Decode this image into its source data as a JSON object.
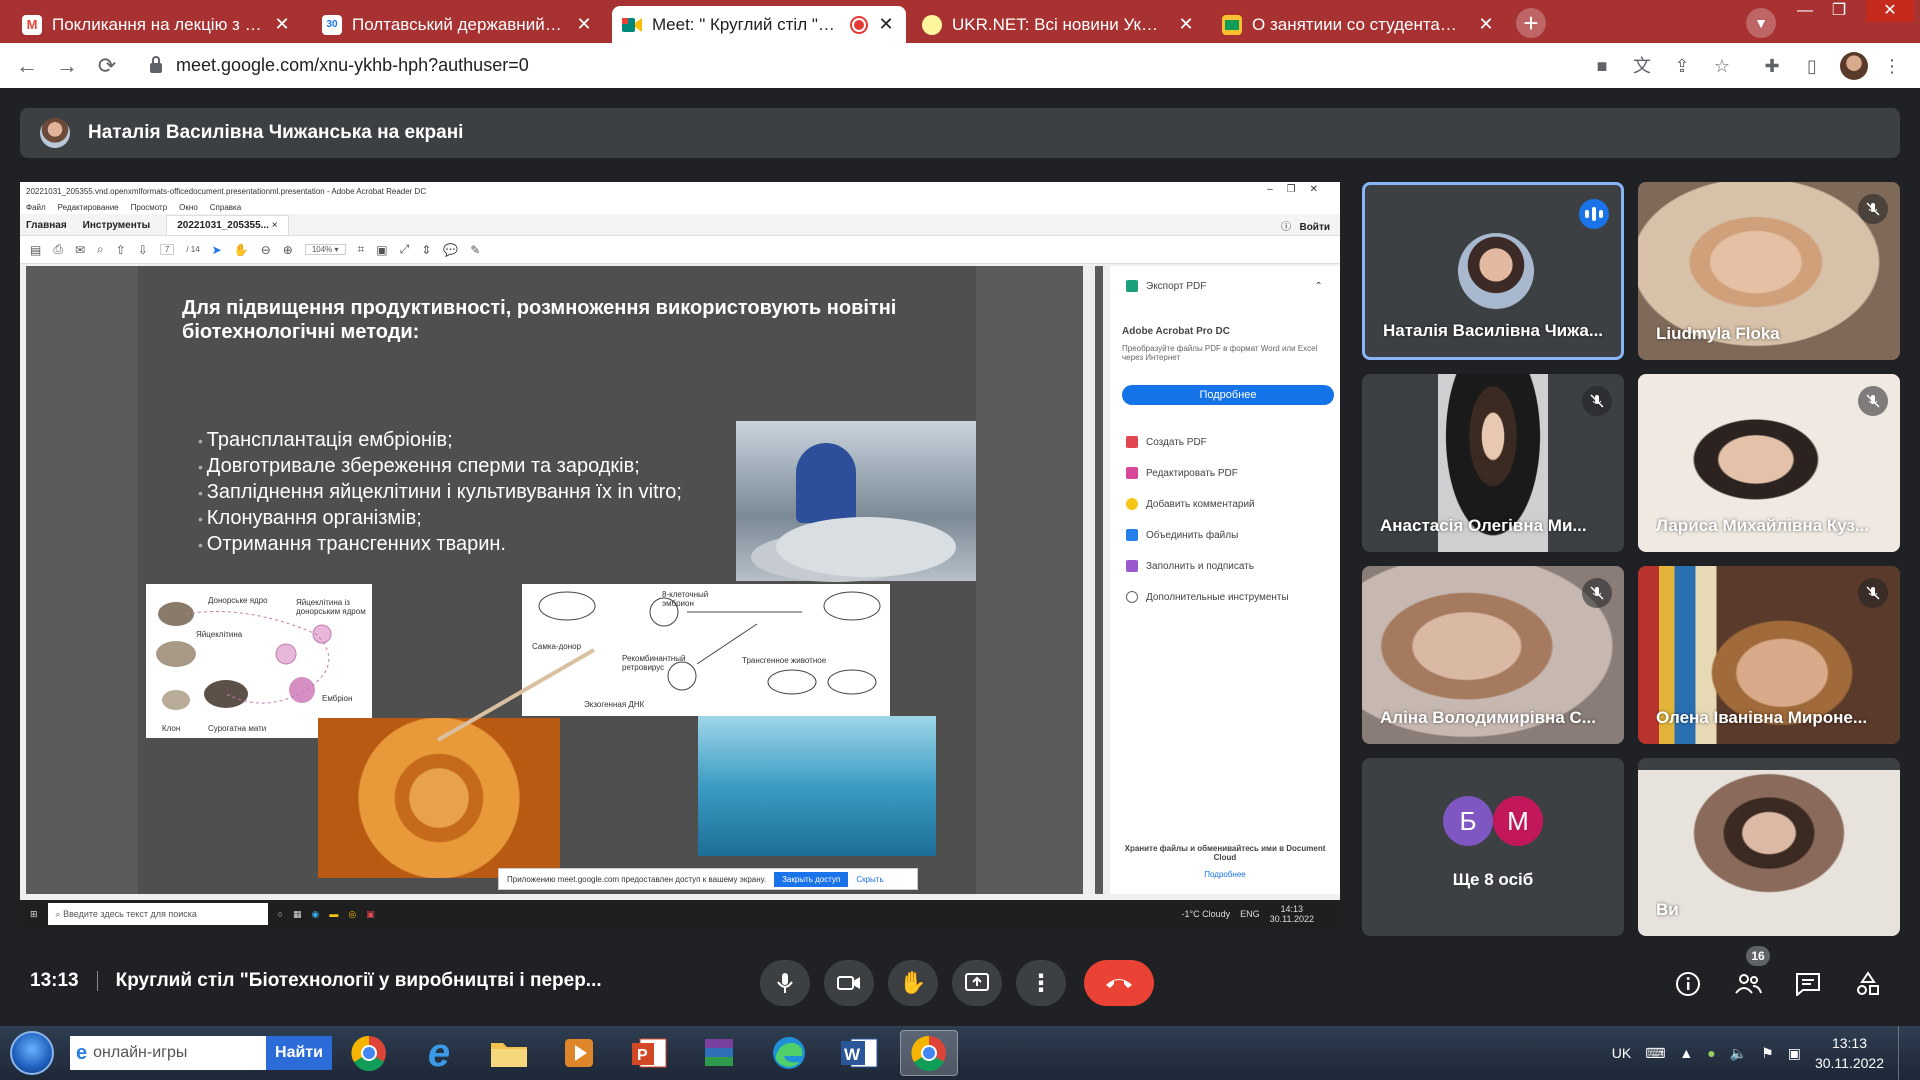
{
  "browser": {
    "tabs": [
      {
        "label": "Покликання на лекцію з Швецією",
        "icon": "gmail-icon",
        "fav": "M",
        "favcolor": "#ea4335",
        "favbg": "#fff"
      },
      {
        "label": "Полтавський державний аграрний",
        "icon": "calendar-icon",
        "fav": "30",
        "favcolor": "#1a73e8",
        "favbg": "#fff"
      },
      {
        "label": "Meet: \" Круглий стіл \"Біотехнології",
        "icon": "meet-icon",
        "fav": "",
        "favcolor": "#00897b",
        "favbg": "#fff",
        "active": true,
        "recording": true
      },
      {
        "label": "UKR.NET: Всі новини України, останні",
        "icon": "ukrnet-icon",
        "fav": "",
        "favcolor": "#f9a825",
        "favbg": "#fff59d"
      },
      {
        "label": "О занятиии со студентами • svetlana",
        "icon": "classroom-icon",
        "fav": "",
        "favcolor": "#0f9d58",
        "favbg": "#fbc02d"
      }
    ],
    "url": "meet.google.com/xnu-ykhb-hph?authuser=0"
  },
  "presenting_banner": "Наталія Василівна Чижанська на екрані",
  "acrobat": {
    "title": "20221031_205355.vnd.openxmlformats-officedocument.presentationml.presentation - Adobe Acrobat Reader DC",
    "menu": [
      "Файл",
      "Редактирование",
      "Просмотр",
      "Окно",
      "Справка"
    ],
    "tab_home": "Главная",
    "tab_tools": "Инструменты",
    "tab_doc": "20221031_205355...",
    "signin": "Войти",
    "page": "7",
    "page_total": "/ 14",
    "zoom": "104%",
    "pane": {
      "export": "Экспорт PDF",
      "product": "Adobe Acrobat Pro DC",
      "desc": "Преобразуйте файлы PDF в формат Word или Excel через Интернет",
      "more_btn": "Подробнее",
      "items": [
        "Создать PDF",
        "Редактировать PDF",
        "Добавить комментарий",
        "Объединить файлы",
        "Заполнить и подписать",
        "Дополнительные инструменты"
      ],
      "cloud": "Храните файлы и обменивайтесь ими в Document Cloud",
      "cloud_link": "Подробнее"
    },
    "notify": {
      "text": "Приложению meet.google.com предоставлен доступ к вашему экрану.",
      "stop": "Закрыть доступ",
      "hide": "Скрыть"
    },
    "taskbar": {
      "search": "Введите здесь текст для поиска",
      "weather": "-1°C  Cloudy",
      "lang": "ENG",
      "time": "14:13",
      "date": "30.11.2022"
    }
  },
  "slide": {
    "title": "Для підвищення продуктивності, розмноження використовують новітні біотехнологічні методи:",
    "bullets": [
      "Трансплантація ембріонів;",
      "Довготривале збереження сперми та зародків;",
      "Запліднення яйцеклітини і культивування їх in vitro;",
      "Клонування організмів;",
      "Отримання трансгенних тварин."
    ],
    "sheep_labels": [
      "Донорське ядро",
      "Яйцеклітина із донорським ядром",
      "Яйцеклітина",
      "Ембріон",
      "Клон",
      "Сурогатна мати"
    ],
    "mice_labels": [
      "8-клеточный эмбрион",
      "Самка-донор",
      "Рекомбинантный ретровирус",
      "Трансгенное животное",
      "Экзогенная ДНК"
    ]
  },
  "participants": [
    {
      "name": "Наталія Василівна Чижа...",
      "speaking": true
    },
    {
      "name": "Liudmyla Floka",
      "muted": true
    },
    {
      "name": "Анастасія Олегівна Ми...",
      "muted": true
    },
    {
      "name": "Лариса Михайлівна Куз...",
      "muted": true
    },
    {
      "name": "Аліна Володимирівна С...",
      "muted": true
    },
    {
      "name": "Олена Іванівна Мироне...",
      "muted": true
    },
    {
      "name": "Ви"
    }
  ],
  "more_tile": {
    "avatars": [
      "Б",
      "М"
    ],
    "label": "Ще 8 осіб"
  },
  "meeting": {
    "time": "13:13",
    "title": "Круглий стіл \"Біотехнології у виробництві і перер...",
    "people_count": "16"
  },
  "taskbar": {
    "search_value": "онлайн-игры",
    "search_button": "Найти",
    "lang": "UK",
    "time": "13:13",
    "date": "30.11.2022"
  },
  "colors": {
    "hangup": "#ea4335",
    "speaking": "#1a73e8",
    "tab_strip": "#a83232"
  }
}
